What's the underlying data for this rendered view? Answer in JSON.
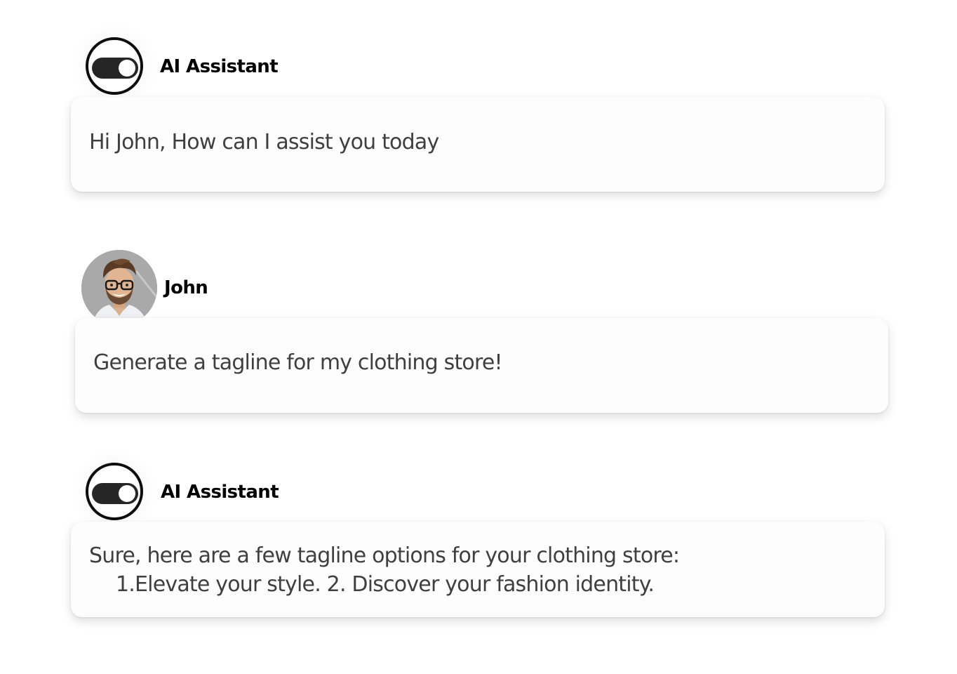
{
  "messages": [
    {
      "sender": "AI Assistant",
      "avatar": "toggle-icon",
      "text": "Hi John, How can I assist you today"
    },
    {
      "sender": "John",
      "avatar": "user-photo",
      "text": "Generate a tagline for my clothing store!"
    },
    {
      "sender": "AI Assistant",
      "avatar": "toggle-icon",
      "text_line1": "Sure, here are a few tagline options for your clothing store:",
      "text_line2": "1.Elevate your style. 2. Discover your fashion identity."
    }
  ],
  "colors": {
    "bubble_bg": "#fdfdfd",
    "text": "#3f3f3f",
    "name": "#000000",
    "toggle_track": "#262626"
  }
}
